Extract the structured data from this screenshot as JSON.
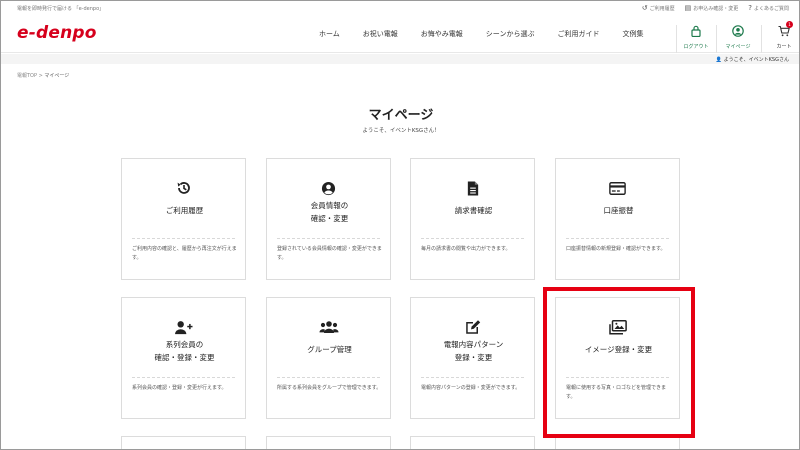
{
  "topbar": {
    "tagline": "電報を即時発行で届ける 「e-denpo」",
    "links": [
      {
        "icon": "history-icon",
        "label": "ご利用履歴"
      },
      {
        "icon": "document-icon",
        "label": "お申込み確認・変更"
      },
      {
        "icon": "question-icon",
        "label": "よくあるご質問"
      }
    ]
  },
  "header": {
    "logo": "e-denpo",
    "nav": [
      "ホーム",
      "お祝い電報",
      "お悔やみ電報",
      "シーンから選ぶ",
      "ご利用ガイド",
      "文例集"
    ],
    "logout_label": "ログアウト",
    "mypage_label": "マイページ",
    "cart_label": "カート",
    "cart_count": "1"
  },
  "subbar": {
    "welcome": "ようこそ、イベントKSGさん"
  },
  "breadcrumb": {
    "home": "電報TOP",
    "sep": ">",
    "current": "マイページ"
  },
  "page": {
    "title": "マイページ",
    "subtitle": "ようこそ、イベントKSGさん！"
  },
  "cards": [
    {
      "icon": "history-icon",
      "title": "ご利用履歴",
      "desc": "ご利用内容の確認と、履歴から再注文が行えます。"
    },
    {
      "icon": "user-circle-icon",
      "title": "会員情報の\n確認・変更",
      "desc": "登録されている会員情報の確認・変更ができます。"
    },
    {
      "icon": "invoice-icon",
      "title": "請求書確認",
      "desc": "毎月の請求書の閲覧や出力ができます。"
    },
    {
      "icon": "credit-card-icon",
      "title": "口座振替",
      "desc": "口座振替情報の新規登録・確認ができます。"
    },
    {
      "icon": "user-plus-icon",
      "title": "系列会員の\n確認・登録・変更",
      "desc": "系列会員の確認・登録・変更が行えます。"
    },
    {
      "icon": "group-icon",
      "title": "グループ管理",
      "desc": "所属する系列会員をグループで管理できます。"
    },
    {
      "icon": "edit-icon",
      "title": "電報内容パターン\n登録・変更",
      "desc": "電報内容パターンの登録・変更ができます。"
    },
    {
      "icon": "images-icon",
      "title": "イメージ登録・変更",
      "desc": "電報に使用する写真・ロゴなどを管理できます。"
    }
  ],
  "colors": {
    "brand": "#d6001c",
    "accent_green": "#1d7a4c",
    "highlight": "#e60012"
  }
}
